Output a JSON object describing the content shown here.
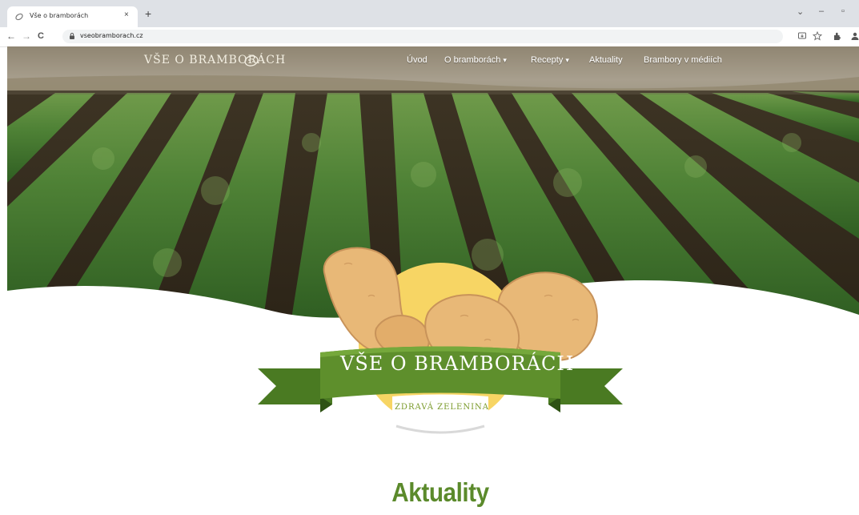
{
  "browser": {
    "tab_title": "Vše o bramborách",
    "tab_close": "×",
    "new_tab": "+",
    "url": "vseobramborach.cz",
    "back": "←",
    "forward": "→",
    "reload": "C",
    "window_controls": {
      "dropdown": "⌄",
      "minimize": "–",
      "maximize": "▫"
    }
  },
  "site": {
    "logo_text": "VŠE O BRAMBORÁCH",
    "nav": [
      {
        "label": "Úvod",
        "dropdown": false
      },
      {
        "label": "O bramborách",
        "dropdown": true
      },
      {
        "label": "Recepty",
        "dropdown": true
      },
      {
        "label": "Aktuality",
        "dropdown": false
      },
      {
        "label": "Brambory v médiích",
        "dropdown": false
      }
    ],
    "caret": "▾"
  },
  "emblem": {
    "title": "VŠE O BRAMBORÁCH",
    "subtitle": "ZDRAVÁ ZELENINA"
  },
  "main": {
    "section_heading": "Aktuality"
  },
  "colors": {
    "accent_green": "#5b8a2b",
    "ribbon_green": "#5e8f2c",
    "potato": "#e8b877",
    "sun_yellow": "#f7d564"
  }
}
